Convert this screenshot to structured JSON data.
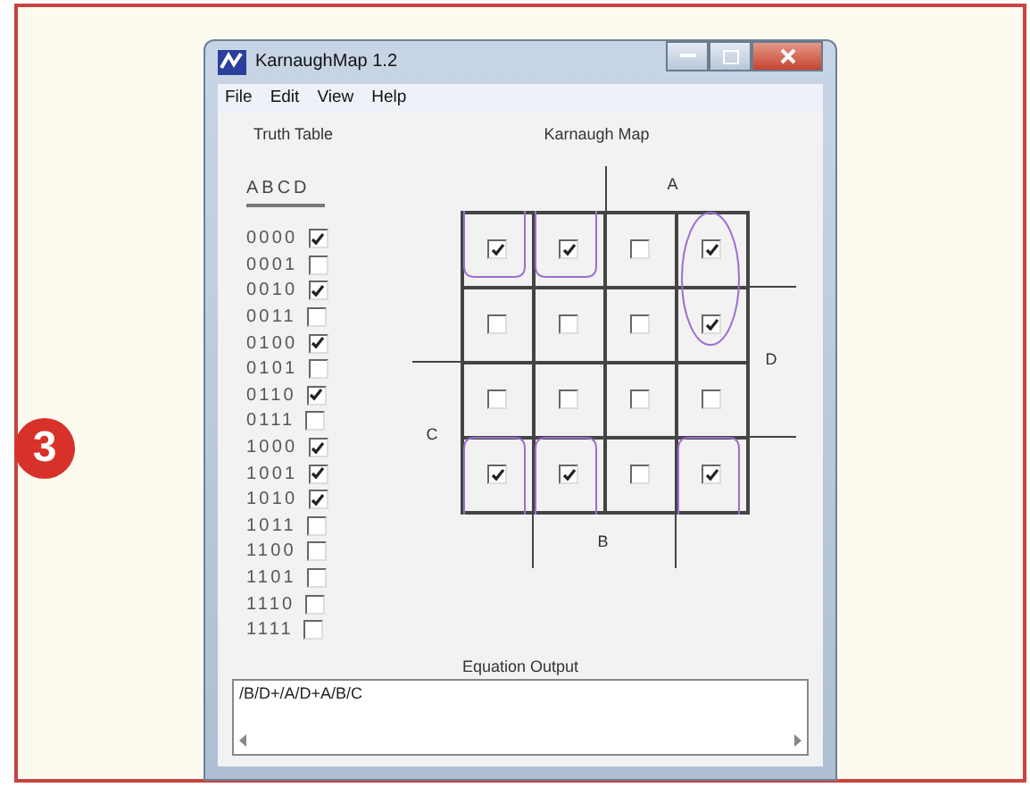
{
  "step_badge": "3",
  "window": {
    "title": "KarnaughMap 1.2"
  },
  "menu": [
    "File",
    "Edit",
    "View",
    "Help"
  ],
  "truth_table": {
    "title": "Truth Table",
    "header": "ABCD",
    "rows": [
      {
        "inputs": "0000",
        "checked": true
      },
      {
        "inputs": "0001",
        "checked": false
      },
      {
        "inputs": "0010",
        "checked": true
      },
      {
        "inputs": "0011",
        "checked": false
      },
      {
        "inputs": "0100",
        "checked": true
      },
      {
        "inputs": "0101",
        "checked": false
      },
      {
        "inputs": "0110",
        "checked": true
      },
      {
        "inputs": "0111",
        "checked": false
      },
      {
        "inputs": "1000",
        "checked": true
      },
      {
        "inputs": "1001",
        "checked": true
      },
      {
        "inputs": "1010",
        "checked": true
      },
      {
        "inputs": "1011",
        "checked": false
      },
      {
        "inputs": "1100",
        "checked": false
      },
      {
        "inputs": "1101",
        "checked": false
      },
      {
        "inputs": "1110",
        "checked": false
      },
      {
        "inputs": "1111",
        "checked": false
      }
    ]
  },
  "karnaugh_map": {
    "title": "Karnaugh Map",
    "label_a": "A",
    "label_b": "B",
    "label_c": "C",
    "label_d": "D",
    "rows": [
      {
        "cells": [
          {
            "checked": true
          },
          {
            "checked": true
          },
          {
            "checked": false
          },
          {
            "checked": true
          }
        ]
      },
      {
        "cells": [
          {
            "checked": false
          },
          {
            "checked": false
          },
          {
            "checked": false
          },
          {
            "checked": true
          }
        ]
      },
      {
        "cells": [
          {
            "checked": false
          },
          {
            "checked": false
          },
          {
            "checked": false
          },
          {
            "checked": false
          }
        ]
      },
      {
        "cells": [
          {
            "checked": true
          },
          {
            "checked": true
          },
          {
            "checked": false
          },
          {
            "checked": true
          }
        ]
      }
    ]
  },
  "equation_output": {
    "label": "Equation Output",
    "value": "/B/D+/A/D+A/B/C"
  }
}
